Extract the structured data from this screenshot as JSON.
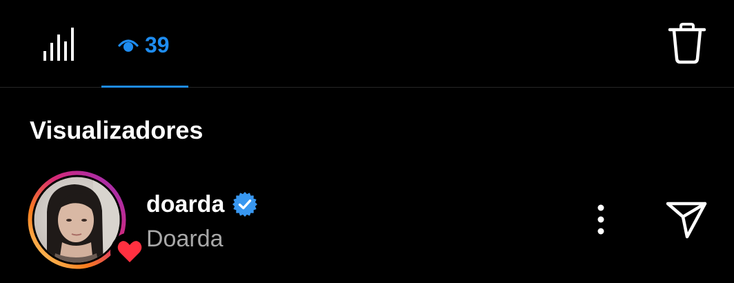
{
  "tabs": {
    "insights": {
      "icon": "bar-chart-icon"
    },
    "viewers": {
      "icon": "eye-icon",
      "count": "39",
      "active": true
    }
  },
  "toolbar": {
    "delete_icon": "trash-icon"
  },
  "section": {
    "title": "Visualizadores"
  },
  "viewers": [
    {
      "username": "doarda",
      "full_name": "Doarda",
      "verified": true,
      "liked": true,
      "avatar": "profile-photo",
      "more_icon": "more-vertical-icon",
      "send_icon": "send-icon"
    }
  ],
  "colors": {
    "background": "#000000",
    "accent": "#1e8cf0",
    "secondary_text": "#a8a8a8",
    "verified_badge": "#3897f0",
    "heart": "#ff3040",
    "divider": "#262626"
  }
}
